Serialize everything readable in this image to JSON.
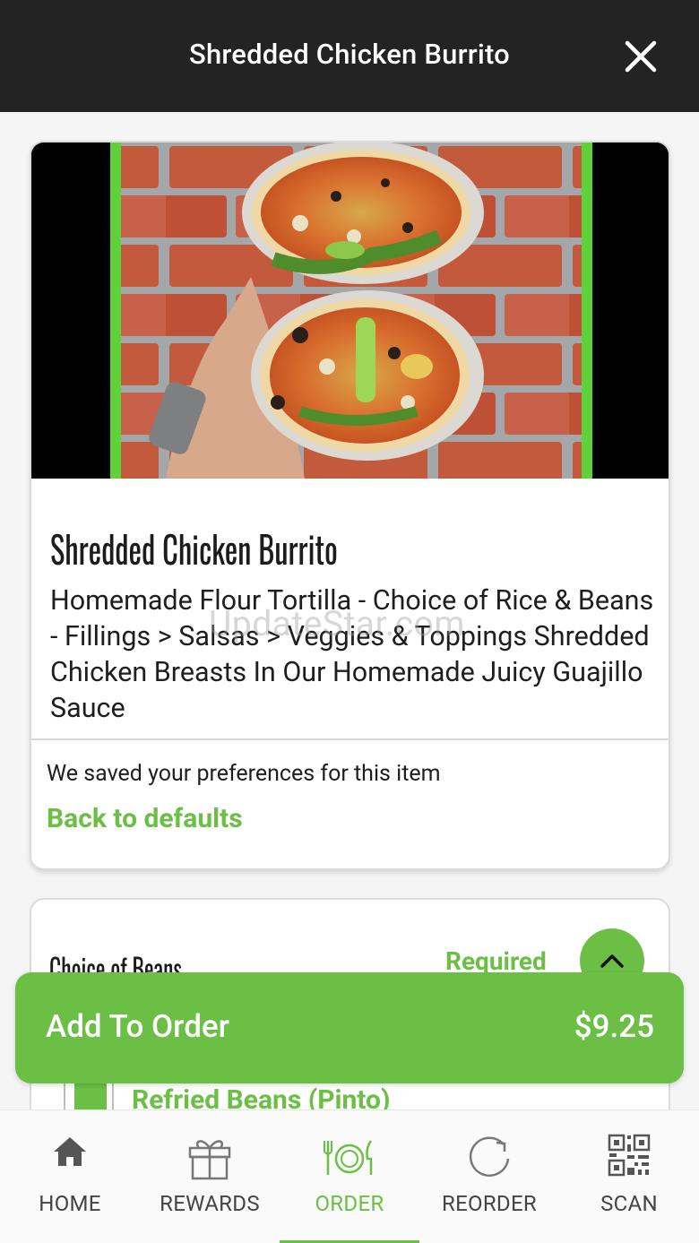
{
  "header": {
    "title": "Shredded Chicken Burrito"
  },
  "item": {
    "name": "Shredded Chicken Burrito",
    "description": "Homemade Flour Tortilla - Choice of Rice & Beans - Fillings > Salsas > Veggies & Toppings Shredded Chicken Breasts In Our Homemade Juicy Guajillo Sauce",
    "watermark": "UpdateStar.com",
    "preferences_note": "We saved your preferences for this item",
    "back_to_defaults": "Back to defaults"
  },
  "options": {
    "group_title": "Choice of Beans",
    "required_label": "Required",
    "visible_option": "Refried Beans (Pinto)"
  },
  "order": {
    "add_label": "Add To Order",
    "price": "$9.25"
  },
  "nav": {
    "items": [
      {
        "label": "HOME",
        "icon": "home-icon"
      },
      {
        "label": "REWARDS",
        "icon": "gift-icon"
      },
      {
        "label": "ORDER",
        "icon": "plate-utensils-icon"
      },
      {
        "label": "REORDER",
        "icon": "refresh-icon"
      },
      {
        "label": "SCAN",
        "icon": "qr-code-icon"
      }
    ],
    "active": "ORDER"
  },
  "colors": {
    "brand_green": "#6cbf45",
    "header_bg": "#232323"
  }
}
